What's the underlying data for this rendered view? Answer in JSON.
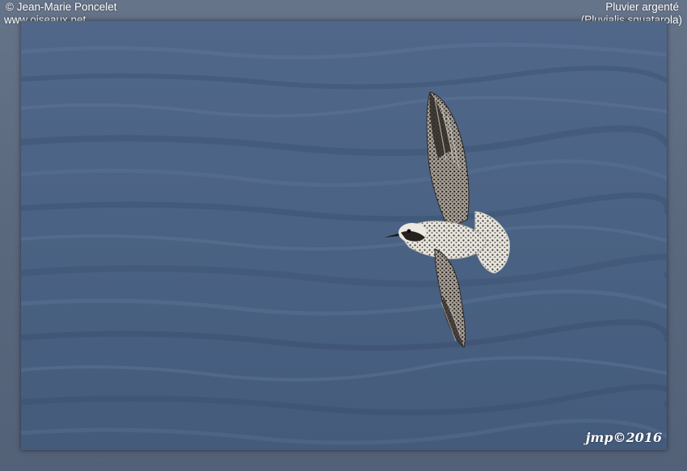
{
  "header": {
    "copyright_line": "© Jean-Marie Poncelet",
    "website": "www.oiseaux.net",
    "common_name": "Pluvier argenté",
    "scientific_name": "(Pluvialis squatarola)"
  },
  "photo": {
    "subject": "grey-plover-in-flight",
    "background": "sea-water",
    "signature": "jmp©2016"
  }
}
